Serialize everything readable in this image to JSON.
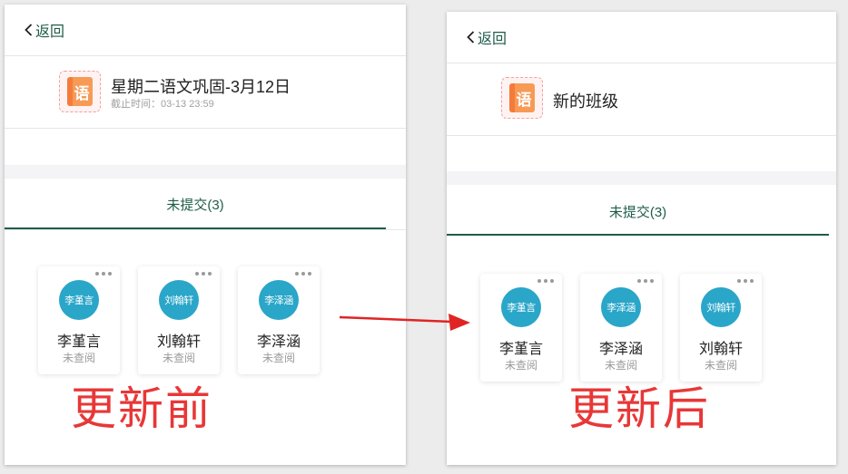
{
  "before": {
    "back_label": "返回",
    "subject_glyph": "语",
    "homework_title": "星期二语文巩固-3月12日",
    "deadline": "截止时间：03-13 23:59",
    "tab_label": "未提交(3)",
    "students": [
      {
        "avatar_text": "李堇言",
        "name": "李堇言",
        "status": "未查阅"
      },
      {
        "avatar_text": "刘翰轩",
        "name": "刘翰轩",
        "status": "未查阅"
      },
      {
        "avatar_text": "李泽涵",
        "name": "李泽涵",
        "status": "未查阅"
      }
    ],
    "caption": "更新前"
  },
  "after": {
    "back_label": "返回",
    "subject_glyph": "语",
    "homework_title": "新的班级",
    "tab_label": "未提交(3)",
    "students": [
      {
        "avatar_text": "李堇言",
        "name": "李堇言",
        "status": "未查阅"
      },
      {
        "avatar_text": "李泽涵",
        "name": "李泽涵",
        "status": "未查阅"
      },
      {
        "avatar_text": "刘翰轩",
        "name": "刘翰轩",
        "status": "未查阅"
      }
    ],
    "caption": "更新后"
  },
  "icons": {
    "back": "chevron-left-icon",
    "subject": "chinese-book-icon",
    "more": "more-dots-icon",
    "arrow": "arrow-right-icon"
  },
  "colors": {
    "accent": "#1f5c4a",
    "avatar": "#2aa6c9",
    "caption": "#e83737",
    "arrow": "#e02424"
  }
}
